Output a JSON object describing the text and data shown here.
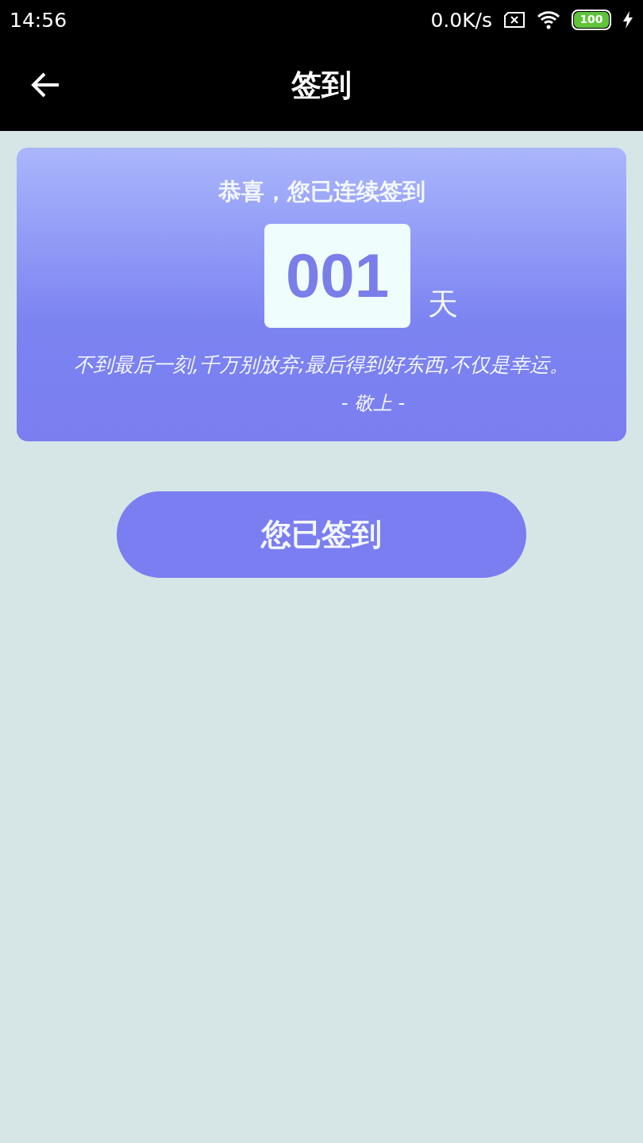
{
  "status_bar": {
    "time": "14:56",
    "net_speed": "0.0K/s",
    "battery": "100"
  },
  "app_bar": {
    "title": "签到"
  },
  "streak_card": {
    "heading": "恭喜，您已连续签到",
    "days": "001",
    "unit": "天",
    "quote": "不到最后一刻,千万别放弃;最后得到好东西,不仅是幸运。",
    "signature": "- 敬上 -"
  },
  "checkin_button": {
    "label": "您已签到"
  }
}
